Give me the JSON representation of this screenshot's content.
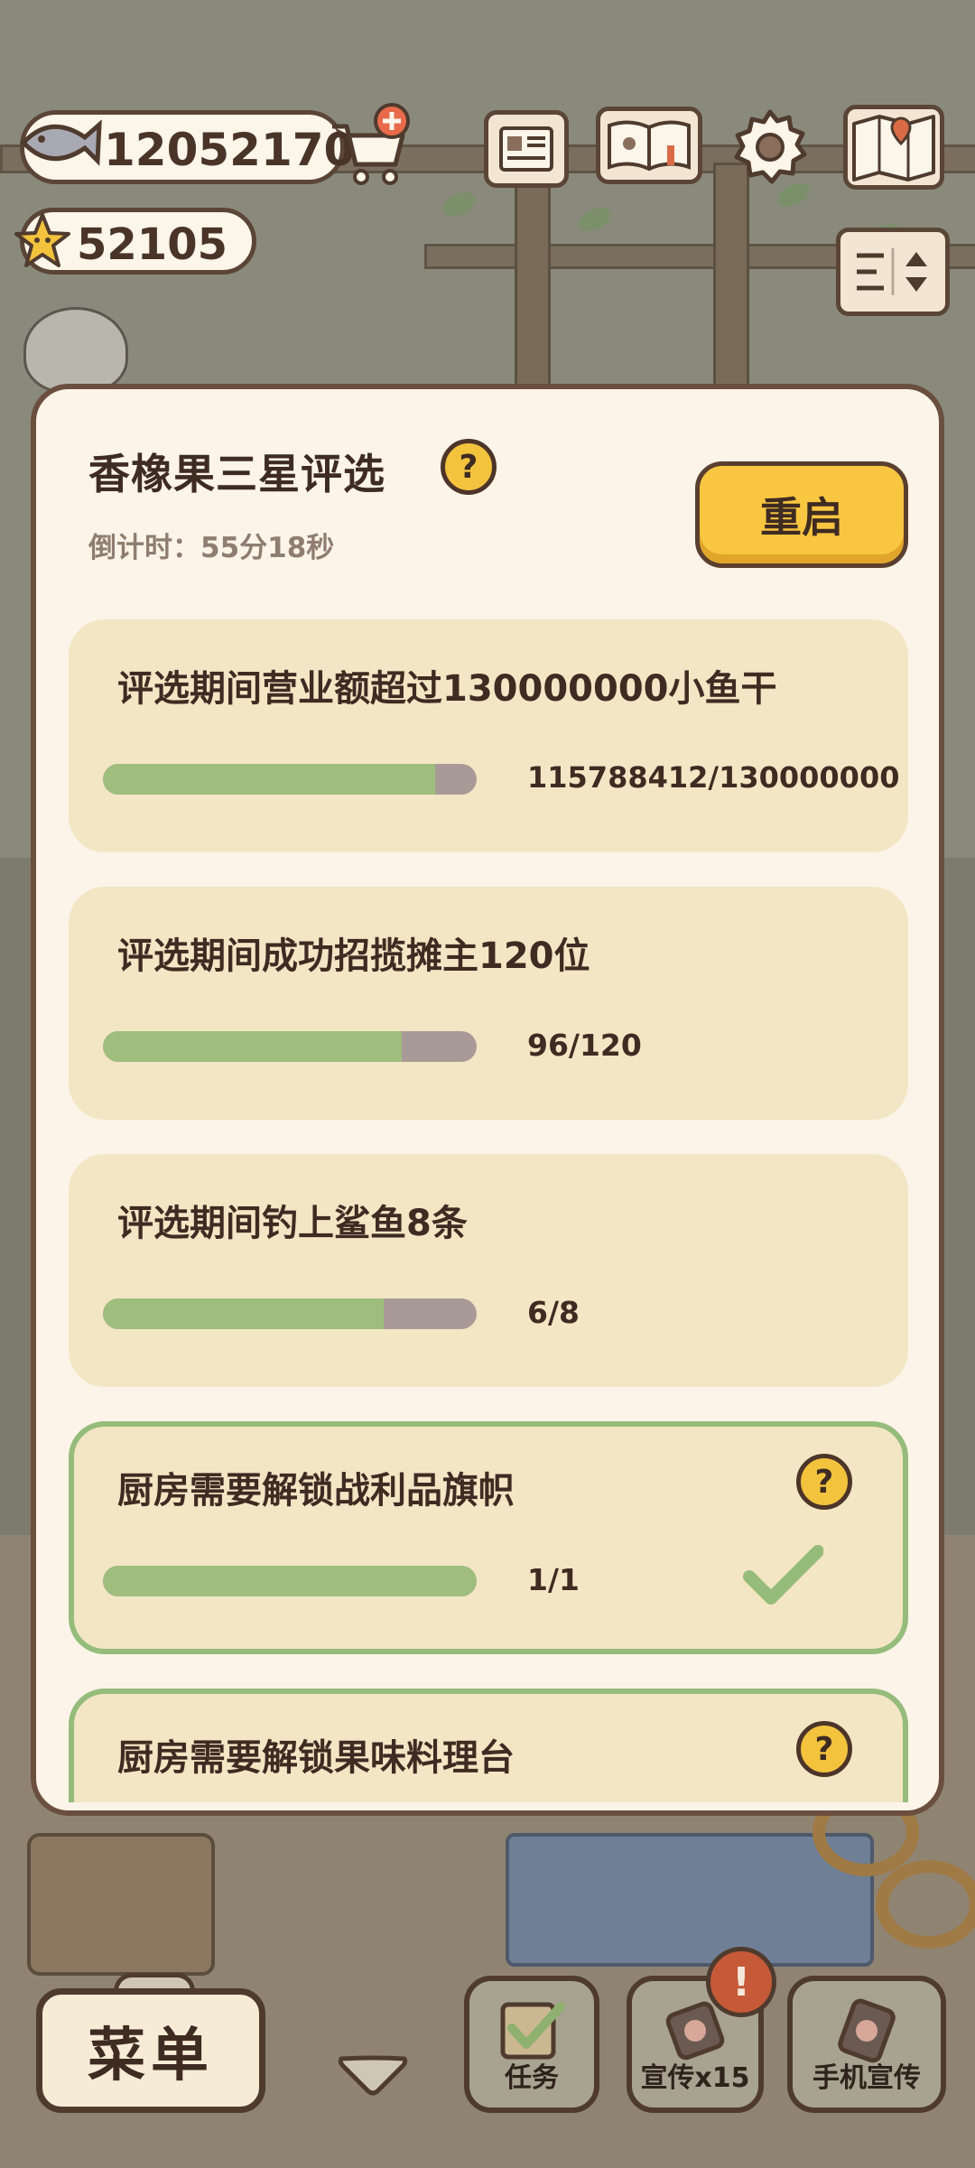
{
  "hud": {
    "fish_count": "12052170",
    "star_count": "52105",
    "icons": [
      "fish-icon",
      "star-icon",
      "cart-add-icon",
      "newspaper-icon",
      "book-icon",
      "settings-gear-icon",
      "map-icon",
      "sort-toggle-icon"
    ]
  },
  "dialog": {
    "title": "香橡果三星评选",
    "help_symbol": "?",
    "countdown": "倒计时：55分18秒",
    "restart_label": "重启",
    "tasks": [
      {
        "title": "评选期间营业额超过130000000小鱼干",
        "progress_text": "115788412/130000000",
        "progress": 0.89,
        "completed": false
      },
      {
        "title": "评选期间成功招揽摊主120位",
        "progress_text": "96/120",
        "progress": 0.8,
        "completed": false
      },
      {
        "title": "评选期间钓上鲨鱼8条",
        "progress_text": "6/8",
        "progress": 0.75,
        "completed": false
      },
      {
        "title": "厨房需要解锁战利品旗帜",
        "progress_text": "1/1",
        "progress": 1.0,
        "completed": true
      },
      {
        "title": "厨房需要解锁果味料理台",
        "progress_text": "",
        "progress": null,
        "completed": false
      }
    ]
  },
  "bottom": {
    "menu_label": "菜单",
    "tasks_label": "任务",
    "promote_label": "宣传x15",
    "phone_promote_label": "手机宣传",
    "alert_symbol": "!"
  },
  "colors": {
    "accent_yellow": "#f8c640",
    "progress_green": "#9fbe7e",
    "progress_track": "#a89a96",
    "card_bg": "#f3e6c4",
    "dialog_bg": "#fcf4e9",
    "completed_border": "#95bc7a"
  }
}
